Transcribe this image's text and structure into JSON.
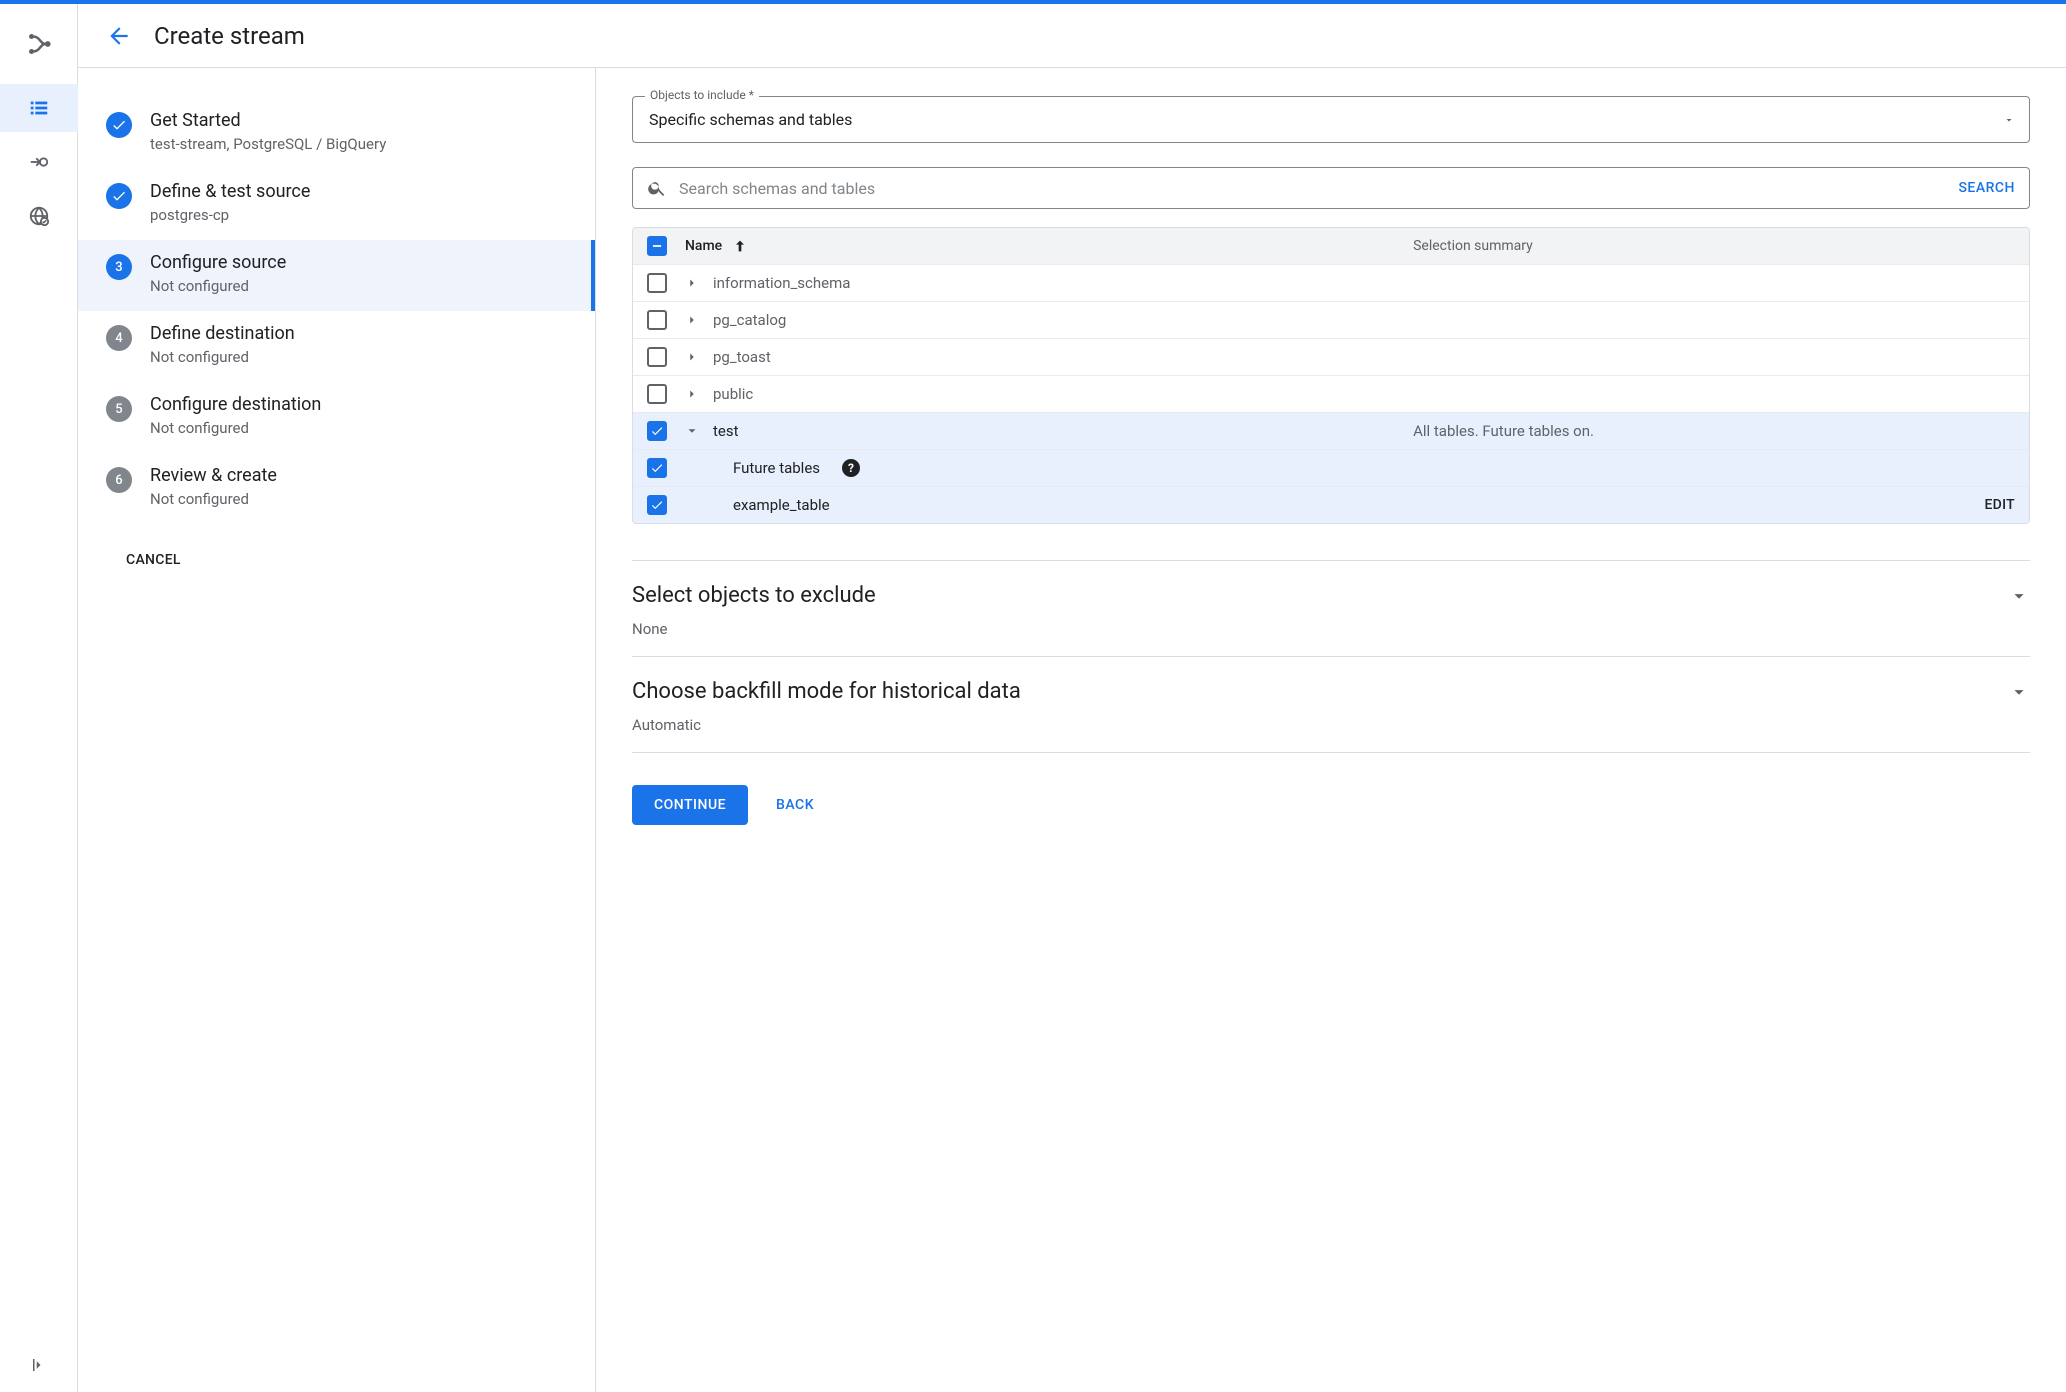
{
  "header": {
    "title": "Create stream"
  },
  "steps": [
    {
      "title": "Get Started",
      "sub": "test-stream, PostgreSQL / BigQuery",
      "state": "done"
    },
    {
      "title": "Define & test source",
      "sub": "postgres-cp",
      "state": "done"
    },
    {
      "title": "Configure source",
      "sub": "Not configured",
      "state": "current"
    },
    {
      "title": "Define destination",
      "sub": "Not configured",
      "state": "future"
    },
    {
      "title": "Configure destination",
      "sub": "Not configured",
      "state": "future"
    },
    {
      "title": "Review & create",
      "sub": "Not configured",
      "state": "future"
    }
  ],
  "step_numbers": {
    "3": "3",
    "4": "4",
    "5": "5",
    "6": "6"
  },
  "cancel_label": "CANCEL",
  "objects_field": {
    "legend": "Objects to include *",
    "value": "Specific schemas and tables"
  },
  "search": {
    "placeholder": "Search schemas and tables",
    "button": "SEARCH"
  },
  "table": {
    "head_name": "Name",
    "head_summary": "Selection summary",
    "rows": [
      {
        "name": "information_schema",
        "checked": false,
        "expanded": false,
        "depth": 0
      },
      {
        "name": "pg_catalog",
        "checked": false,
        "expanded": false,
        "depth": 0
      },
      {
        "name": "pg_toast",
        "checked": false,
        "expanded": false,
        "depth": 0
      },
      {
        "name": "public",
        "checked": false,
        "expanded": false,
        "depth": 0
      },
      {
        "name": "test",
        "checked": true,
        "expanded": true,
        "depth": 0,
        "summary": "All tables. Future tables on."
      },
      {
        "name": "Future tables",
        "checked": true,
        "depth": 1,
        "help": true
      },
      {
        "name": "example_table",
        "checked": true,
        "depth": 1,
        "edit": "EDIT"
      }
    ]
  },
  "exclude": {
    "title": "Select objects to exclude",
    "value": "None"
  },
  "backfill": {
    "title": "Choose backfill mode for historical data",
    "value": "Automatic"
  },
  "actions": {
    "continue": "CONTINUE",
    "back": "BACK"
  }
}
